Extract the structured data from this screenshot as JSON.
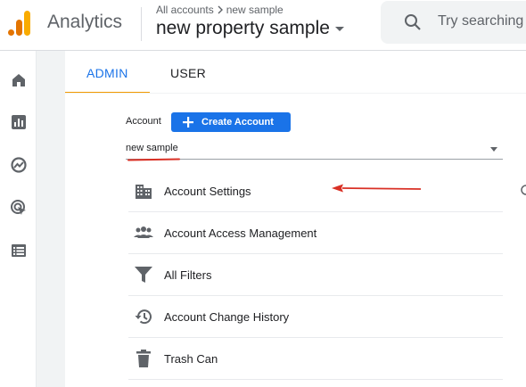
{
  "header": {
    "app_title": "Analytics",
    "breadcrumb": {
      "parent": "All accounts",
      "current": "new sample"
    },
    "property_name": "new property sample",
    "search_placeholder": "Try searching"
  },
  "rail": {
    "items": [
      {
        "icon": "home-icon"
      },
      {
        "icon": "reports-icon"
      },
      {
        "icon": "explore-icon"
      },
      {
        "icon": "advertising-icon"
      },
      {
        "icon": "configure-icon"
      }
    ]
  },
  "tabs": [
    {
      "label": "ADMIN",
      "active": true
    },
    {
      "label": "USER",
      "active": false
    }
  ],
  "account": {
    "label": "Account",
    "create_button": "Create Account",
    "selected": "new sample"
  },
  "menu": [
    {
      "icon": "building-icon",
      "label": "Account Settings"
    },
    {
      "icon": "people-icon",
      "label": "Account Access Management"
    },
    {
      "icon": "filter-icon",
      "label": "All Filters"
    },
    {
      "icon": "history-icon",
      "label": "Account Change History"
    },
    {
      "icon": "trash-icon",
      "label": "Trash Can"
    }
  ],
  "colors": {
    "accent": "#1a73e8",
    "tab_underline": "#f29900",
    "annotation_red": "#d93025",
    "logo_orange": "#f9ab00",
    "logo_dark_orange": "#e37400"
  }
}
